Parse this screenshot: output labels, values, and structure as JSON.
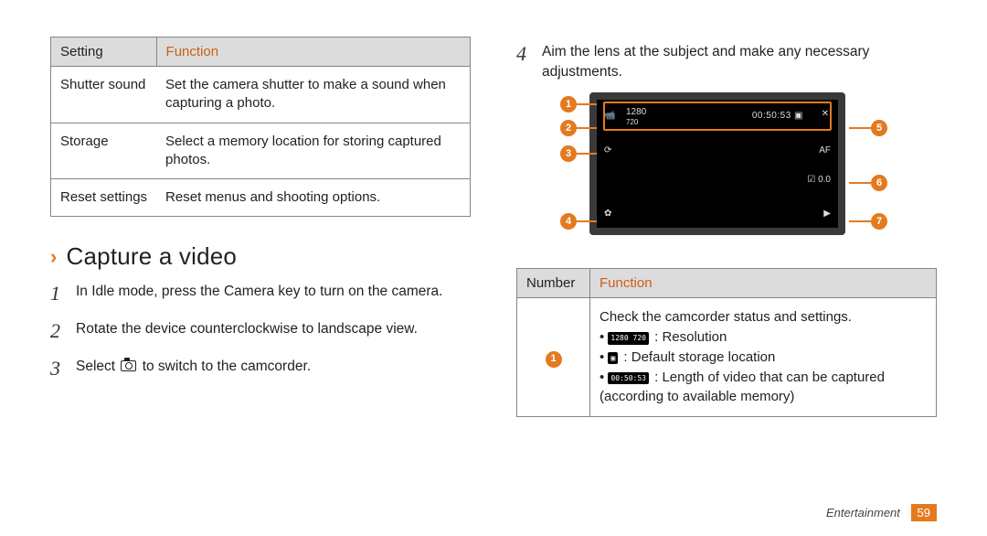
{
  "settings_table": {
    "headers": [
      "Setting",
      "Function"
    ],
    "rows": [
      {
        "setting": "Shutter sound",
        "function": "Set the camera shutter to make a sound when capturing a photo."
      },
      {
        "setting": "Storage",
        "function": "Select a memory location for storing captured photos."
      },
      {
        "setting": "Reset settings",
        "function": "Reset menus and shooting options."
      }
    ]
  },
  "heading": "Capture a video",
  "steps": {
    "s1": {
      "num": "1",
      "text": "In Idle mode, press the Camera key to turn on the camera."
    },
    "s2": {
      "num": "2",
      "text": "Rotate the device counterclockwise to landscape view."
    },
    "s3": {
      "num": "3",
      "text_before": "Select ",
      "text_after": " to switch to the camcorder."
    },
    "s4": {
      "num": "4",
      "text": "Aim the lens at the subject and make any necessary adjustments."
    }
  },
  "diagram": {
    "callouts": [
      "1",
      "2",
      "3",
      "4",
      "5",
      "6",
      "7"
    ],
    "screen": {
      "resolution": "1280",
      "resolution_sub": "720",
      "time": "00:50:53",
      "store_icon": "▣",
      "mode_icon": "✕",
      "cam_icon": "📹",
      "switch_icon": "⟳",
      "gear_icon": "✿",
      "af_icon": "AF",
      "ev_icon": "☑\n0.0",
      "rec_icon": "▶"
    }
  },
  "functions_table": {
    "headers": [
      "Number",
      "Function"
    ],
    "row1": {
      "num": "1",
      "intro": "Check the camcorder status and settings.",
      "items": {
        "a": {
          "icon": "1280\n720",
          "text": ": Resolution"
        },
        "b": {
          "icon": "▣",
          "text": ": Default storage location"
        },
        "c": {
          "icon": "00:50:53",
          "text": ": Length of video that can be captured (according to available memory)"
        }
      }
    }
  },
  "footer": {
    "section": "Entertainment",
    "page": "59"
  }
}
